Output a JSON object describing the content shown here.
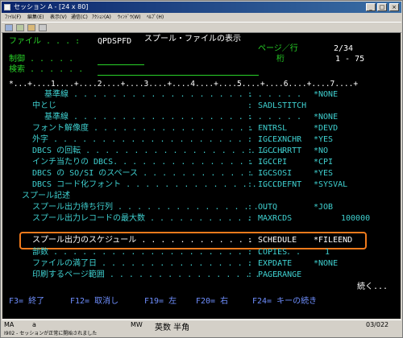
{
  "window": {
    "title": "セッション A - [24 x 80]",
    "controls": [
      "_",
      "□",
      "×"
    ]
  },
  "menubar": [
    {
      "label": "ﾌｧｲﾙ(F)"
    },
    {
      "label": "編集(E)"
    },
    {
      "label": "表示(V)"
    },
    {
      "label": "通信(C)"
    },
    {
      "label": "ｱｸｼｮﾝ(A)"
    },
    {
      "label": "ｳｨﾝﾄﾞｳ(W)"
    },
    {
      "label": "ﾍﾙﾌﾟ(H)"
    }
  ],
  "screen": {
    "header": {
      "file_label": "ファイル . . . :",
      "file_value": "QPDSPFD",
      "title": "スプール・ファイルの表示",
      "page_line_label": "ページ／行",
      "page_line_value": "2/34",
      "control_label": "制御 . . . . .",
      "column_label": "桁",
      "column_value": "1 - 75",
      "search_label": "検索 . . . . . ."
    },
    "ruler": "*...+....1....+....2....+....3....+....4....+....5....+....6....+....7....+",
    "rows": [
      {
        "label": "基準線 . . . . . . . . . . . . . . . . . . . . . . . .",
        "sep": ":",
        "kw": "",
        "val": "*NONE"
      },
      {
        "label": "中とじ",
        "sep": ":",
        "kw": "SADLSTITCH",
        "val": ""
      },
      {
        "label": "基準線 . . . . . . . . . . . . . . . . . . . . . . . .",
        "sep": ":",
        "kw": "",
        "val": "*NONE"
      },
      {
        "label": "フォント解像度 . . . . . . . . . . . . . . . . . . .",
        "sep": ":",
        "kw": "FNTRSL",
        "val": "*DEVD"
      },
      {
        "label": "外字 . . . . . . . . . . . . . . . . . . . . . . . . . .",
        "sep": ":",
        "kw": "IGCEXNCHR",
        "val": "*YES"
      },
      {
        "label": "DBCS の回転 . . . . . . . . . . . . . . . . . . . . .",
        "sep": ":",
        "kw": "IGCCHRRTT",
        "val": "*NO"
      },
      {
        "label": "インチ当たりの DBCS. . . . . . . . . . . . . . . . . .",
        "sep": ":",
        "kw": "IGCCPI",
        "val": "*CPI"
      },
      {
        "label": "DBCS の SO/SI のスペース . . . . . . . . . . . . . .",
        "sep": ":",
        "kw": "IGCSOSI",
        "val": "*YES"
      },
      {
        "label": "DBCS コード化フォント . . . . . . . . . . . . . . . .",
        "sep": ":",
        "kw": "IGCCDEFNT",
        "val": "*SYSVAL"
      },
      {
        "label": "スプール記述",
        "sep": "",
        "kw": "",
        "val": ""
      },
      {
        "label": "スプール出力待ち行列 . . . . . . . . . . . . . . . .",
        "sep": ":",
        "kw": "OUTQ",
        "val": "*JOB"
      },
      {
        "label": "スプール出力レコードの最大数 . . . . . . . . . . .",
        "sep": ":",
        "kw": "MAXRCDS",
        "val": "100000"
      },
      {
        "label": "スプール出力のスケジュール . . . . . . . . . . . .",
        "sep": ":",
        "kw": "SCHEDULE",
        "val": "*FILEEND"
      },
      {
        "label": "部数 . . . . . . . . . . . . . . . . . . . . . . . . . .",
        "sep": ":",
        "kw": "COPIES",
        "val": "1"
      },
      {
        "label": "ファイルの満了日 . . . . . . . . . . . . . . . . . . .",
        "sep": ":",
        "kw": "EXPDATE",
        "val": "*NONE"
      },
      {
        "label": "印刷するページ範囲 . . . . . . . . . . . . . . . . . .",
        "sep": ":",
        "kw": "PAGERANGE",
        "val": ""
      }
    ],
    "more": "続く...",
    "fkeys": [
      "F3= 終了",
      "F12= 取消し",
      "F19= 左",
      "F20= 右",
      "F24= キーの続き"
    ]
  },
  "status": {
    "mode": "MA",
    "cursor": "a",
    "mw": "MW",
    "ime": "英数 半角",
    "position": "03/022",
    "message": "I902 - セッションが正常に開始されました"
  },
  "colors": {
    "screen_bg": "#000000",
    "green": "#28d228",
    "cyan": "#3fd0d0",
    "white": "#ffffff",
    "blue": "#6f8fff",
    "highlight_border": "#f07a1c"
  }
}
